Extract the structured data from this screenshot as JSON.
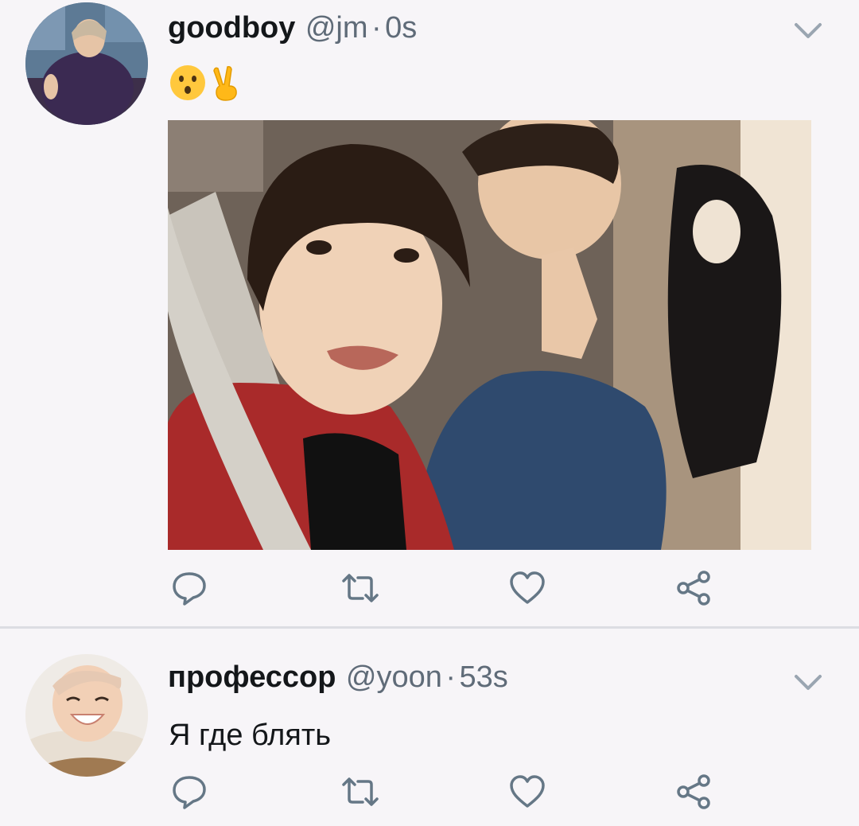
{
  "tweets": [
    {
      "display_name": "goodboy",
      "handle": "@jm",
      "separator": "·",
      "time": "0s",
      "text_emojis": [
        "hushed-face-emoji",
        "victory-hand-emoji"
      ],
      "has_photo": true
    },
    {
      "display_name": "профессор",
      "handle": "@yoon",
      "separator": "·",
      "time": "53s",
      "text": "Я где блять",
      "has_photo": false
    }
  ],
  "icons": {
    "reply": "reply-icon",
    "retweet": "retweet-icon",
    "like": "heart-icon",
    "share": "share-icon",
    "menu": "chevron-down-icon"
  },
  "colors": {
    "background": "#f7f5f8",
    "text_primary": "#14171a",
    "text_secondary": "#5f6b78",
    "icon": "#657786",
    "divider": "#dcdde3"
  }
}
